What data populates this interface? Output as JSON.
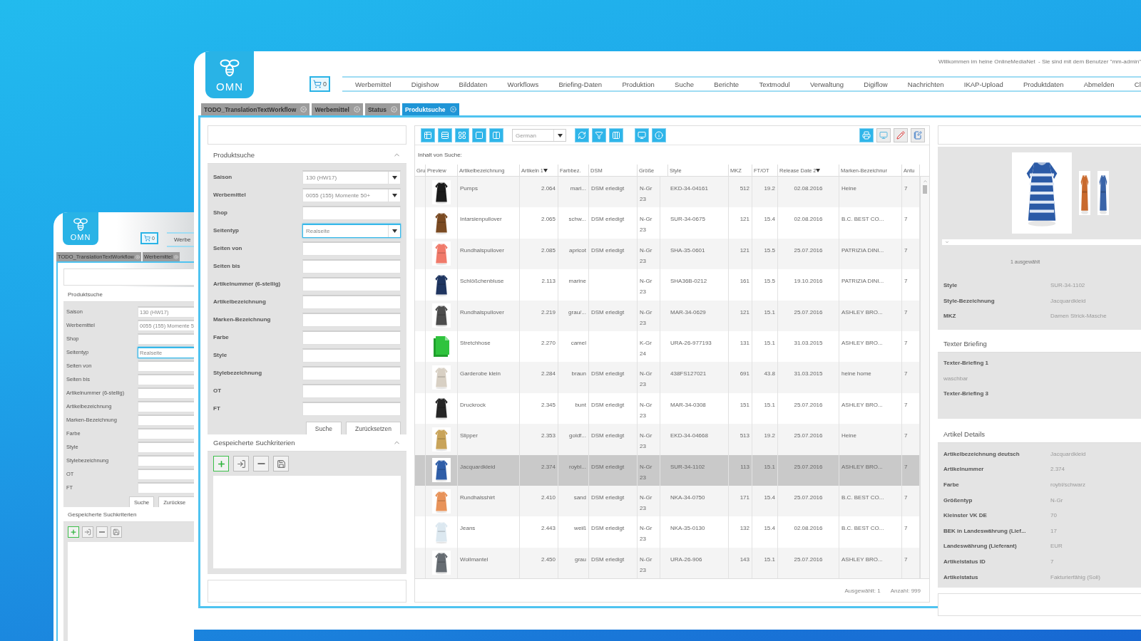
{
  "back_window": {
    "logo": "OMN",
    "cart_count": "0",
    "nav_items": [
      "Werbe"
    ],
    "tabs": [
      {
        "label": "TODO_TranslationTextWorkflow",
        "selected": false
      },
      {
        "label": "Werbemittel",
        "selected": false
      }
    ],
    "search_title": "Produktsuche",
    "fields": [
      {
        "label": "Saison",
        "value": "130 (HW17)",
        "focused": false
      },
      {
        "label": "Werbemittel",
        "value": "0055 (155) Momente 5",
        "focused": false
      },
      {
        "label": "Shop",
        "focused": false
      },
      {
        "label": "Seitentyp",
        "value": "Realseite",
        "focused": true
      },
      {
        "label": "Seiten von",
        "focused": false
      },
      {
        "label": "Seiten bis",
        "focused": false
      },
      {
        "label": "Artikelnummer (6-stellig)",
        "focused": false
      },
      {
        "label": "Artikelbezeichnung",
        "focused": false
      },
      {
        "label": "Marken-Bezeichnung",
        "focused": false
      },
      {
        "label": "Farbe",
        "focused": false
      },
      {
        "label": "Style",
        "focused": false
      },
      {
        "label": "Stylebezeichnung",
        "focused": false
      },
      {
        "label": "OT",
        "focused": false
      },
      {
        "label": "FT",
        "focused": false
      }
    ],
    "buttons": [
      "Suche",
      "Zurückse"
    ],
    "saved_title": "Gespeicherte Suchkriterien"
  },
  "header": {
    "logo": "OMN",
    "welcome": "Willkommen im heine OnlineMediaNet  - Sie sind mit dem Benutzer \"mm-admin\"",
    "cart_count": "0",
    "nav_items": [
      "Werbemittel",
      "Digishow",
      "Bilddaten",
      "Workflows",
      "Briefing-Daten",
      "Produktion",
      "Suche",
      "Berichte",
      "Textmodul",
      "Verwaltung",
      "Digiflow",
      "Nachrichten",
      "IKAP-Upload",
      "Produktdaten",
      "Abmelden",
      "Cl"
    ]
  },
  "tabs": [
    {
      "label": "TODO_TranslationTextWorkflow",
      "selected": false
    },
    {
      "label": "Werbemittel",
      "selected": false
    },
    {
      "label": "Status",
      "selected": false
    },
    {
      "label": "Produktsuche",
      "selected": true
    }
  ],
  "search_panel": {
    "title": "Produktsuche",
    "fields": [
      {
        "label": "Saison",
        "kind": "select",
        "value": "130 (HW17)",
        "focused": false
      },
      {
        "label": "Werbemittel",
        "kind": "select",
        "value": "0055 (155) Momente 50+",
        "focused": false
      },
      {
        "label": "Shop",
        "kind": "text",
        "focused": false
      },
      {
        "label": "Seitentyp",
        "kind": "select",
        "value": "Realseite",
        "focused": true
      },
      {
        "label": "Seiten von",
        "kind": "text",
        "focused": false
      },
      {
        "label": "Seiten bis",
        "kind": "text",
        "focused": false
      },
      {
        "label": "Artikelnummer (6-stellig)",
        "kind": "text",
        "focused": false
      },
      {
        "label": "Artikelbezeichnung",
        "kind": "text",
        "focused": false
      },
      {
        "label": "Marken-Bezeichnung",
        "kind": "text",
        "focused": false
      },
      {
        "label": "Farbe",
        "kind": "text",
        "focused": false
      },
      {
        "label": "Style",
        "kind": "text",
        "focused": false
      },
      {
        "label": "Stylebezeichnung",
        "kind": "text",
        "focused": false
      },
      {
        "label": "OT",
        "kind": "text",
        "focused": false
      },
      {
        "label": "FT",
        "kind": "text",
        "focused": false
      }
    ],
    "buttons": [
      "Suche",
      "Zurücksetzen"
    ]
  },
  "saved_panel": {
    "title": "Gespeicherte Suchkriterien"
  },
  "results": {
    "language": "German",
    "caption": "Inhalt von Suche:",
    "columns": [
      {
        "label": "Gru"
      },
      {
        "label": "Preview"
      },
      {
        "label": "Artikelbezeichnung"
      },
      {
        "label": "Artikeln",
        "sort": {
          "order": "1"
        }
      },
      {
        "label": "Farbbez."
      },
      {
        "label": "DSM"
      },
      {
        "label": "Größe"
      },
      {
        "label": "Style"
      },
      {
        "label": "MKZ"
      },
      {
        "label": "FT/OT"
      },
      {
        "label": "Release Date",
        "sort": {
          "order": "2"
        }
      },
      {
        "label": "Marken-Bezeichnur"
      },
      {
        "label": "Antu"
      }
    ],
    "rows": [
      {
        "preview": {
          "kind": "picture"
        },
        "selected": false,
        "cells": [
          "",
          "",
          "Pumps",
          "2.064",
          "mari...",
          "DSM erledigt",
          "N-Gr 23",
          "EKD-34-04161",
          "512",
          "19.2",
          "02.08.2016",
          "Heine",
          "7"
        ]
      },
      {
        "preview": {
          "kind": "picture"
        },
        "selected": false,
        "cells": [
          "",
          "",
          "Intarsienpullover",
          "2.065",
          "schw...",
          "DSM erledigt",
          "N-Gr 23",
          "SUR-34-0675",
          "121",
          "15.4",
          "02.08.2016",
          "B.C. BEST CO...",
          "7"
        ]
      },
      {
        "preview": {
          "kind": "picture"
        },
        "selected": false,
        "cells": [
          "",
          "",
          "Rundhalspullover",
          "2.085",
          "apricot",
          "DSM erledigt",
          "N-Gr 23",
          "SHA-35-0601",
          "121",
          "15.5",
          "25.07.2016",
          "PATRIZIA DINI...",
          "7"
        ]
      },
      {
        "preview": {
          "kind": "picture"
        },
        "selected": false,
        "cells": [
          "",
          "",
          "Schlößchenbluse",
          "2.113",
          "marine",
          null,
          "N-Gr 23",
          "SHA36B-0212",
          "161",
          "15.5",
          "19.10.2016",
          "PATRIZIA DINI...",
          "7"
        ]
      },
      {
        "preview": {
          "kind": "picture"
        },
        "selected": false,
        "cells": [
          "",
          "",
          "Rundhalspullover",
          "2.219",
          "grau/...",
          "DSM erledigt",
          "N-Gr 23",
          "MAR-34-0629",
          "121",
          "15.1",
          "25.07.2016",
          "ASHLEY BRO...",
          "7"
        ]
      },
      {
        "preview": {
          "kind": "document"
        },
        "selected": false,
        "cells": [
          "",
          "",
          "Stretchhose",
          "2.270",
          "camel",
          null,
          "K-Gr 24",
          "URA-26-977193",
          "131",
          "15.1",
          "31.03.2015",
          "ASHLEY BRO...",
          "7"
        ]
      },
      {
        "preview": {
          "kind": "picture"
        },
        "selected": false,
        "cells": [
          "",
          "",
          "Garderobe klein",
          "2.284",
          "braun",
          "DSM erledigt",
          "N-Gr 23",
          "438FS127021",
          "691",
          "43.8",
          "31.03.2015",
          "heine home",
          "7"
        ]
      },
      {
        "preview": {
          "kind": "picture"
        },
        "selected": false,
        "cells": [
          "",
          "",
          "Druckrock",
          "2.345",
          "bunt",
          "DSM erledigt",
          "N-Gr 23",
          "MAR-34-0308",
          "151",
          "15.1",
          "25.07.2016",
          "ASHLEY BRO...",
          "7"
        ]
      },
      {
        "preview": {
          "kind": "picture"
        },
        "selected": false,
        "cells": [
          "",
          "",
          "Slipper",
          "2.353",
          "goldf...",
          "DSM erledigt",
          "N-Gr 23",
          "EKD-34-04668",
          "513",
          "19.2",
          "25.07.2016",
          "Heine",
          "7"
        ]
      },
      {
        "preview": {
          "kind": "picture"
        },
        "selected": true,
        "cells": [
          "",
          "",
          "Jacquardkleid",
          "2.374",
          "roybl...",
          "DSM erledigt",
          "N-Gr 23",
          "SUR-34-1102",
          "113",
          "15.1",
          "25.07.2016",
          "ASHLEY BRO...",
          "7"
        ]
      },
      {
        "preview": {
          "kind": "picture"
        },
        "selected": false,
        "cells": [
          "",
          "",
          "Rundhalsshirt",
          "2.410",
          "sand",
          "DSM erledigt",
          "N-Gr 23",
          "NKA-34-0750",
          "171",
          "15.4",
          "25.07.2016",
          "B.C. BEST CO...",
          "7"
        ]
      },
      {
        "preview": {
          "kind": "picture"
        },
        "selected": false,
        "cells": [
          "",
          "",
          "Jeans",
          "2.443",
          "weiß",
          "DSM erledigt",
          "N-Gr 23",
          "NKA-35-0130",
          "132",
          "15.4",
          "02.08.2016",
          "B.C. BEST CO...",
          "7"
        ]
      },
      {
        "preview": {
          "kind": "picture"
        },
        "selected": false,
        "cells": [
          "",
          "",
          "Wollmantel",
          "2.450",
          "grau",
          "DSM erledigt",
          "N-Gr 23",
          "URA-26-906",
          "143",
          "15.1",
          "25.07.2016",
          "ASHLEY BRO...",
          "7"
        ]
      }
    ],
    "footer": [
      "Ausgewählt: 1",
      "Anzahl: 999"
    ]
  },
  "detail": {
    "gallery": [
      {
        "kind": "picture"
      },
      {
        "kind": "picture"
      },
      {
        "kind": "picture"
      }
    ],
    "selection": "1 ausgewählt",
    "summary": [
      {
        "label": "Style",
        "value": "SUR-34-1102"
      },
      {
        "label": "Style-Bezeichnung",
        "value": "Jacquardkleid"
      },
      {
        "label": "MKZ",
        "value": "Damen Strick-Masche"
      }
    ],
    "briefing": {
      "title": "Texter Briefing",
      "items": [
        {
          "kind": "label",
          "text": "Texter-Briefing 1"
        },
        {
          "kind": "value",
          "text": "waschbar"
        },
        {
          "kind": "label",
          "text": "Texter-Briefing 3"
        }
      ]
    },
    "details": {
      "title": "Artikel Details",
      "rows": [
        {
          "label": "Artikelbezeichnung deutsch",
          "value": "Jacquardkleid"
        },
        {
          "label": "Artikelnummer",
          "value": "2.374"
        },
        {
          "label": "Farbe",
          "value": "roybl/schwarz"
        },
        {
          "label": "Größentyp",
          "value": "N-Gr"
        },
        {
          "label": "Kleinster VK DE",
          "value": "70"
        },
        {
          "label": "BEK in Landeswährung (Lief...",
          "value": "17"
        },
        {
          "label": "Landeswährung (Lieferant)",
          "value": "EUR"
        },
        {
          "label": "Artikelstatus ID",
          "value": "7"
        },
        {
          "label": "Artikelstatus",
          "value": "Fakturierfähig (Soll)"
        }
      ]
    }
  }
}
